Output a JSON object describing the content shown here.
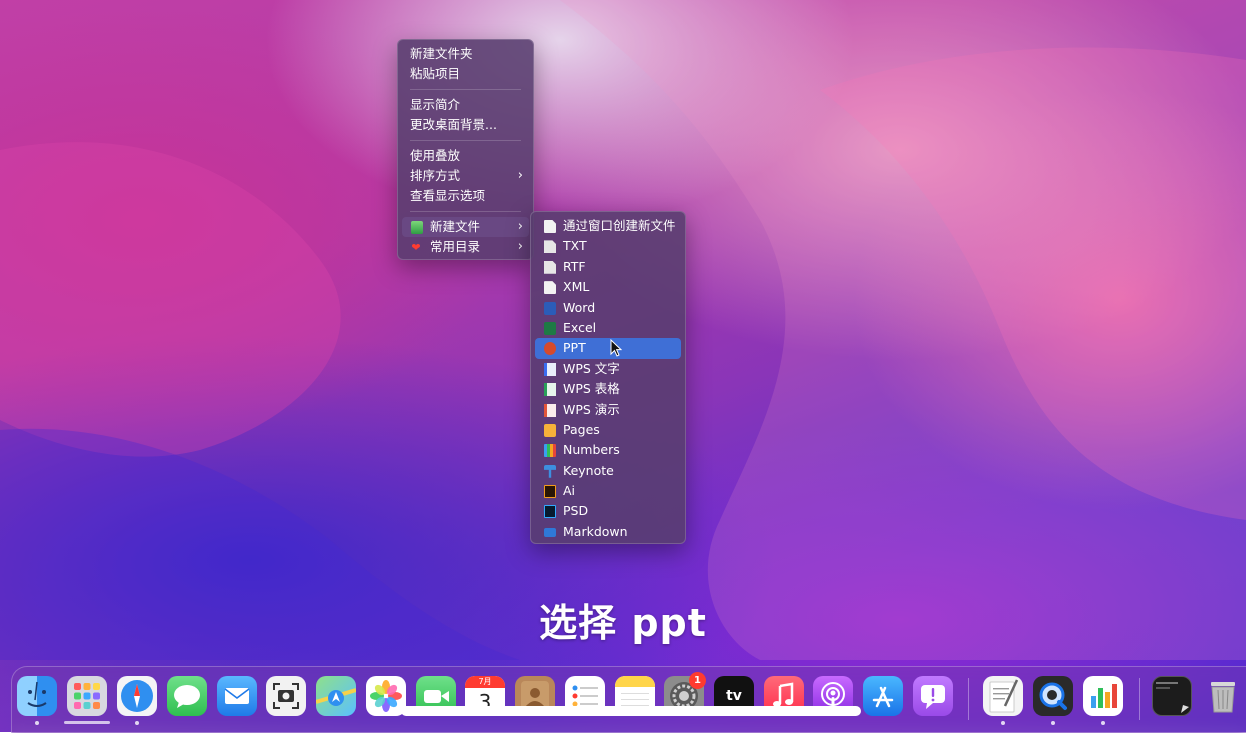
{
  "context_menu": {
    "items": [
      {
        "label": "新建文件夹"
      },
      {
        "label": "粘贴项目"
      },
      {
        "label": "显示简介"
      },
      {
        "label": "更改桌面背景..."
      },
      {
        "label": "使用叠放"
      },
      {
        "label": "排序方式"
      },
      {
        "label": "查看显示选项"
      },
      {
        "label": "新建文件"
      },
      {
        "label": "常用目录"
      }
    ]
  },
  "submenu": {
    "items": [
      {
        "label": "通过窗口创建新文件",
        "icon": "blank-document-icon"
      },
      {
        "label": "TXT",
        "icon": "txt-file-icon"
      },
      {
        "label": "RTF",
        "icon": "rtf-file-icon"
      },
      {
        "label": "XML",
        "icon": "xml-file-icon"
      },
      {
        "label": "Word",
        "icon": "word-icon"
      },
      {
        "label": "Excel",
        "icon": "excel-icon"
      },
      {
        "label": "PPT",
        "icon": "powerpoint-icon",
        "selected": true
      },
      {
        "label": "WPS 文字",
        "icon": "wps-writer-icon"
      },
      {
        "label": "WPS 表格",
        "icon": "wps-spreadsheet-icon"
      },
      {
        "label": "WPS 演示",
        "icon": "wps-presentation-icon"
      },
      {
        "label": "Pages",
        "icon": "pages-icon"
      },
      {
        "label": "Numbers",
        "icon": "numbers-icon"
      },
      {
        "label": "Keynote",
        "icon": "keynote-icon"
      },
      {
        "label": "Ai",
        "icon": "illustrator-icon"
      },
      {
        "label": "PSD",
        "icon": "photoshop-icon"
      },
      {
        "label": "Markdown",
        "icon": "markdown-icon"
      }
    ],
    "selected_color": "#3f6fd6"
  },
  "caption": "选择 ppt",
  "dock": {
    "calendar_month": "7月",
    "calendar_day": "3",
    "settings_badge": "1",
    "tv_label": "tv"
  }
}
